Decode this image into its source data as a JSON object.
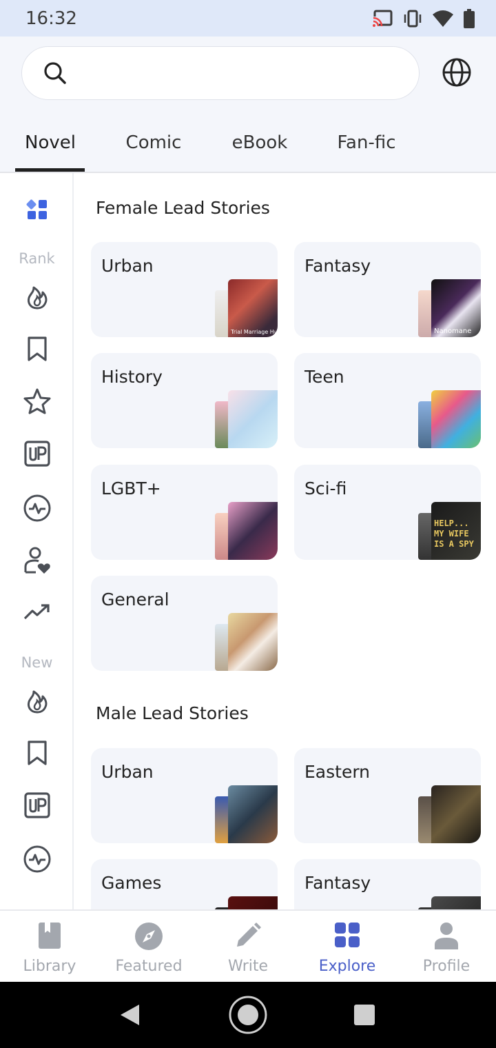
{
  "status_bar": {
    "time": "16:32"
  },
  "top": {
    "tabs": [
      {
        "label": "Novel"
      },
      {
        "label": "Comic"
      },
      {
        "label": "eBook"
      },
      {
        "label": "Fan-fic"
      }
    ],
    "active_tab": "Novel"
  },
  "side_rail": {
    "rank_label": "Rank",
    "new_label": "New"
  },
  "sections": [
    {
      "title": "Female Lead Stories",
      "cards": [
        {
          "label": "Urban",
          "cover_text": "Trial Marriage Hu"
        },
        {
          "label": "Fantasy",
          "cover_text": "Nanomane"
        },
        {
          "label": "History"
        },
        {
          "label": "Teen"
        },
        {
          "label": "LGBT+"
        },
        {
          "label": "Sci-fi",
          "cover_text": "HELP... MY WIFE IS A SPY"
        },
        {
          "label": "General"
        }
      ]
    },
    {
      "title": "Male Lead Stories",
      "cards": [
        {
          "label": "Urban"
        },
        {
          "label": "Eastern"
        },
        {
          "label": "Games"
        },
        {
          "label": "Fantasy"
        }
      ]
    }
  ],
  "bottom_nav": [
    {
      "label": "Library",
      "icon": "book-icon"
    },
    {
      "label": "Featured",
      "icon": "compass-icon"
    },
    {
      "label": "Write",
      "icon": "pencil-icon"
    },
    {
      "label": "Explore",
      "icon": "grid-icon",
      "active": true
    },
    {
      "label": "Profile",
      "icon": "person-icon"
    }
  ],
  "colors": {
    "accent": "#4a5fc8",
    "rail_icon": "#4b4f56",
    "grid_blue": "#3d63e0"
  }
}
